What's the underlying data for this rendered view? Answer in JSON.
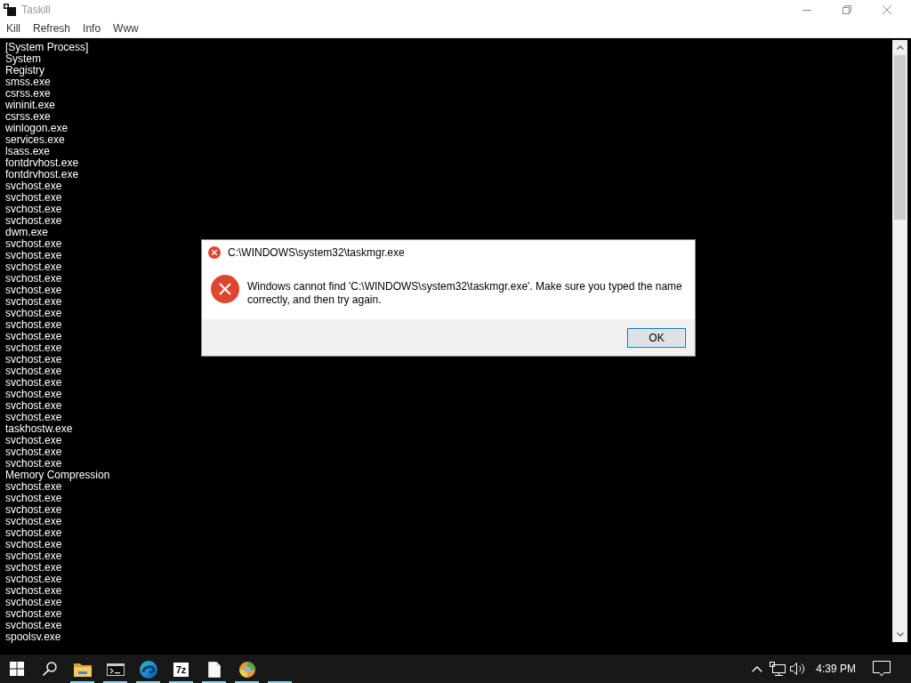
{
  "window": {
    "title": "Taskill",
    "menu": [
      "Kill",
      "Refresh",
      "Info",
      "Www"
    ]
  },
  "processes": [
    "[System Process]",
    "System",
    "Registry",
    "smss.exe",
    "csrss.exe",
    "wininit.exe",
    "csrss.exe",
    "winlogon.exe",
    "services.exe",
    "lsass.exe",
    "fontdrvhost.exe",
    "fontdrvhost.exe",
    "svchost.exe",
    "svchost.exe",
    "svchost.exe",
    "svchost.exe",
    "dwm.exe",
    "svchost.exe",
    "svchost.exe",
    "svchost.exe",
    "svchost.exe",
    "svchost.exe",
    "svchost.exe",
    "svchost.exe",
    "svchost.exe",
    "svchost.exe",
    "svchost.exe",
    "svchost.exe",
    "svchost.exe",
    "svchost.exe",
    "svchost.exe",
    "svchost.exe",
    "svchost.exe",
    "taskhostw.exe",
    "svchost.exe",
    "svchost.exe",
    "svchost.exe",
    "Memory Compression",
    "svchost.exe",
    "svchost.exe",
    "svchost.exe",
    "svchost.exe",
    "svchost.exe",
    "svchost.exe",
    "svchost.exe",
    "svchost.exe",
    "svchost.exe",
    "svchost.exe",
    "svchost.exe",
    "svchost.exe",
    "svchost.exe",
    "spoolsv.exe"
  ],
  "dialog": {
    "title": "C:\\WINDOWS\\system32\\taskmgr.exe",
    "message": "Windows cannot find 'C:\\WINDOWS\\system32\\taskmgr.exe'. Make sure you typed the name correctly, and then try again.",
    "buttons": [
      {
        "label": "OK",
        "default": true
      }
    ]
  },
  "taskbar": {
    "apps": [
      {
        "kind": "folder",
        "running": true
      },
      {
        "kind": "terminal",
        "running": true
      },
      {
        "kind": "browser",
        "running": true
      },
      {
        "kind": "archiver",
        "label": "7z",
        "running": true
      },
      {
        "kind": "document",
        "running": true
      },
      {
        "kind": "paint",
        "running": true
      },
      {
        "kind": "blank",
        "running": true
      }
    ],
    "clock": "4:39 PM"
  }
}
